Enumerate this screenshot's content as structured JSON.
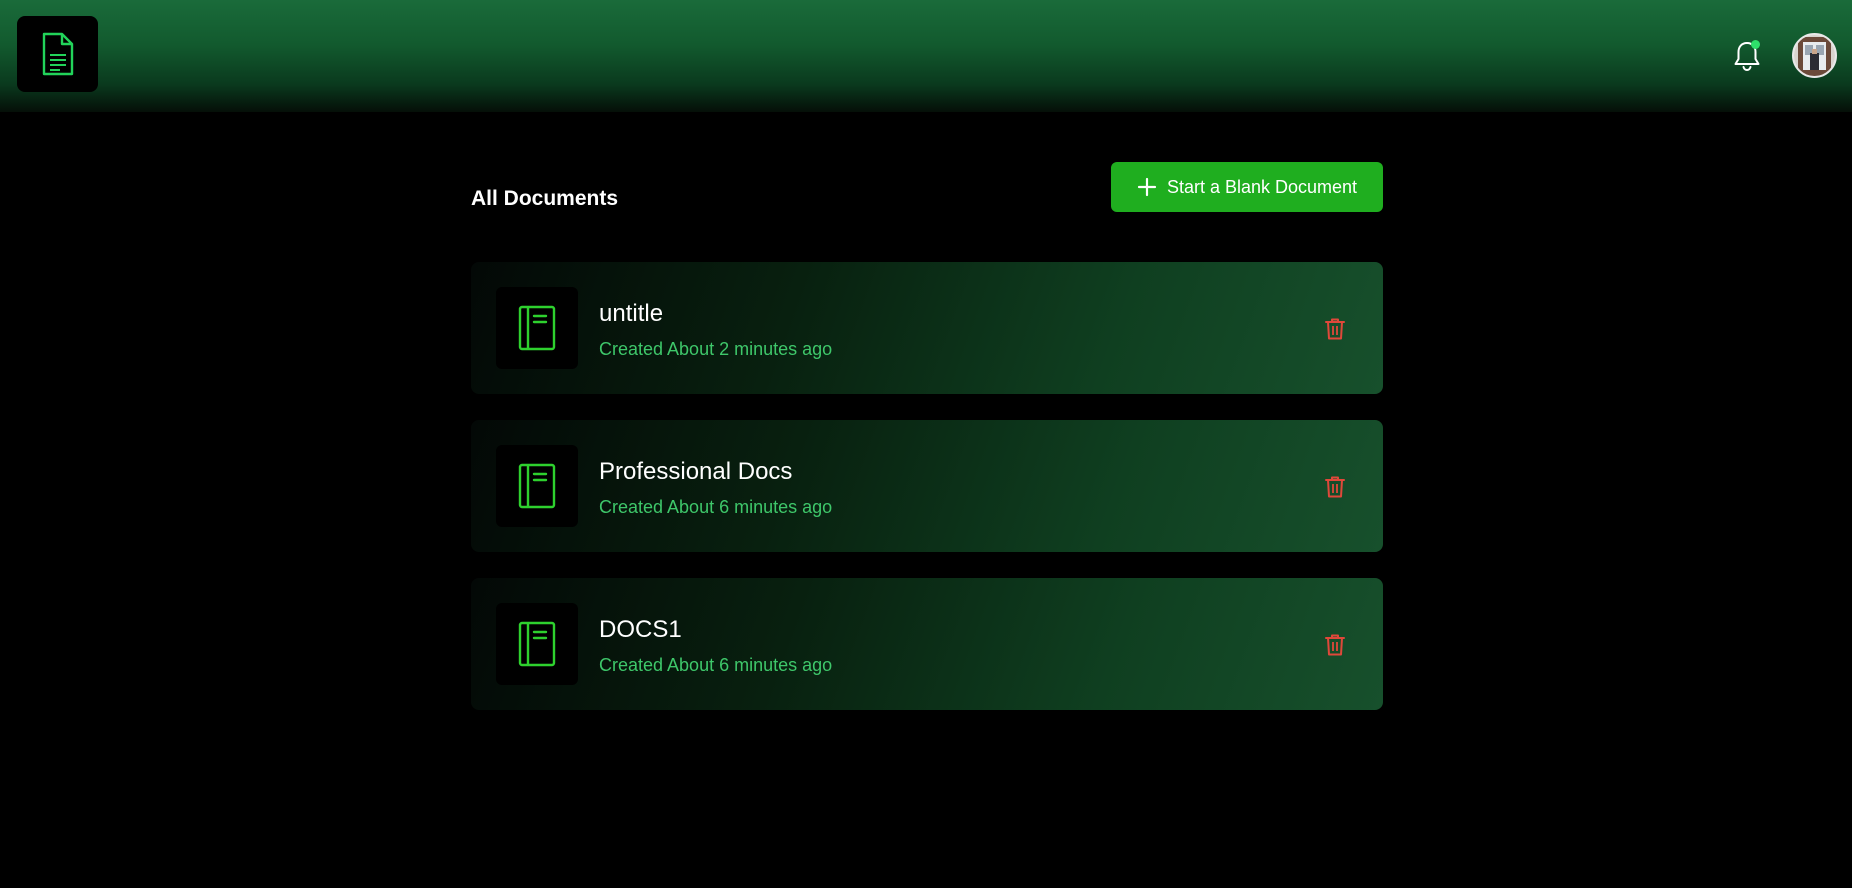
{
  "header": {
    "logo_icon": "document-icon",
    "notification_icon": "bell-icon",
    "notification_dot_color": "#2ee06a",
    "avatar_alt": "user-avatar"
  },
  "main": {
    "section_title": "All Documents",
    "new_document_button": {
      "icon": "plus-icon",
      "label": "Start a Blank Document"
    },
    "documents": [
      {
        "title": "untitle",
        "meta": "Created About 2 minutes ago",
        "icon": "notebook-icon",
        "delete_icon": "trash-icon"
      },
      {
        "title": "Professional Docs",
        "meta": "Created About 6 minutes ago",
        "icon": "notebook-icon",
        "delete_icon": "trash-icon"
      },
      {
        "title": "DOCS1",
        "meta": "Created About 6 minutes ago",
        "icon": "notebook-icon",
        "delete_icon": "trash-icon"
      }
    ]
  },
  "colors": {
    "accent": "#1fae1f",
    "accent_text": "#3ec76a",
    "danger": "#e0483a",
    "background": "#000000"
  }
}
